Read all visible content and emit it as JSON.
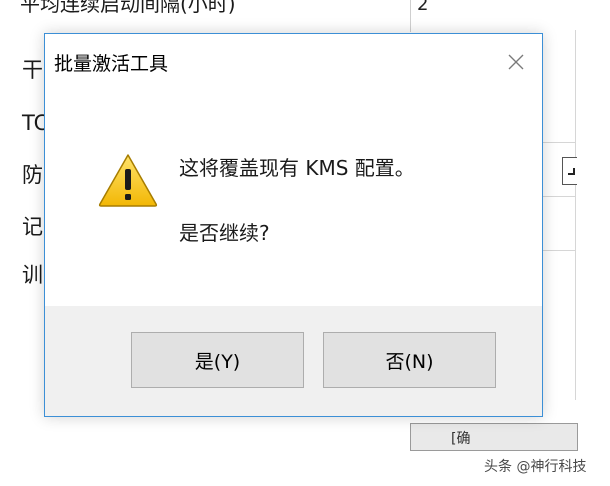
{
  "background_window": {
    "top_row_text": "平均连续启动间隔(小时)",
    "top_row_value": "2",
    "left_fragments": [
      "干",
      "TC",
      "防",
      "记",
      "训"
    ],
    "button_fragment": "[确"
  },
  "dialog": {
    "title": "批量激活工具",
    "message_line1": "这将覆盖现有 KMS 配置。",
    "message_line2": "是否继续?",
    "yes_label": "是(Y)",
    "no_label": "否(N)",
    "icon": "warning-icon",
    "accent_color": "#3c8fd6"
  },
  "watermark": {
    "text": "头条 @神行科技"
  }
}
